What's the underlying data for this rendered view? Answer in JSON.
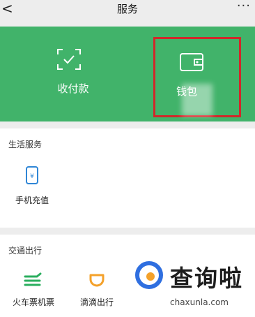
{
  "header": {
    "back_glyph": "<",
    "title": "服务",
    "more_glyph": "···"
  },
  "wallet_panel": {
    "pay_label": "收付款",
    "wallet_label": "钱包",
    "pay_icon": "scan-check-icon",
    "wallet_icon": "wallet-icon"
  },
  "life_services": {
    "title": "生活服务",
    "items": [
      {
        "label": "手机充值",
        "icon": "phone-recharge-icon"
      }
    ]
  },
  "transport": {
    "title": "交通出行",
    "items": [
      {
        "label": "火车票机票",
        "icon": "train-ticket-icon"
      },
      {
        "label": "滴滴出行",
        "icon": "didi-icon"
      }
    ]
  },
  "watermark": {
    "brand_cn": "查询啦",
    "brand_en": "chaxunla.com"
  },
  "colors": {
    "green": "#41b36a",
    "highlight_red": "#d0282a",
    "accent_blue": "#2f86d6",
    "accent_orange": "#f4a12a"
  }
}
